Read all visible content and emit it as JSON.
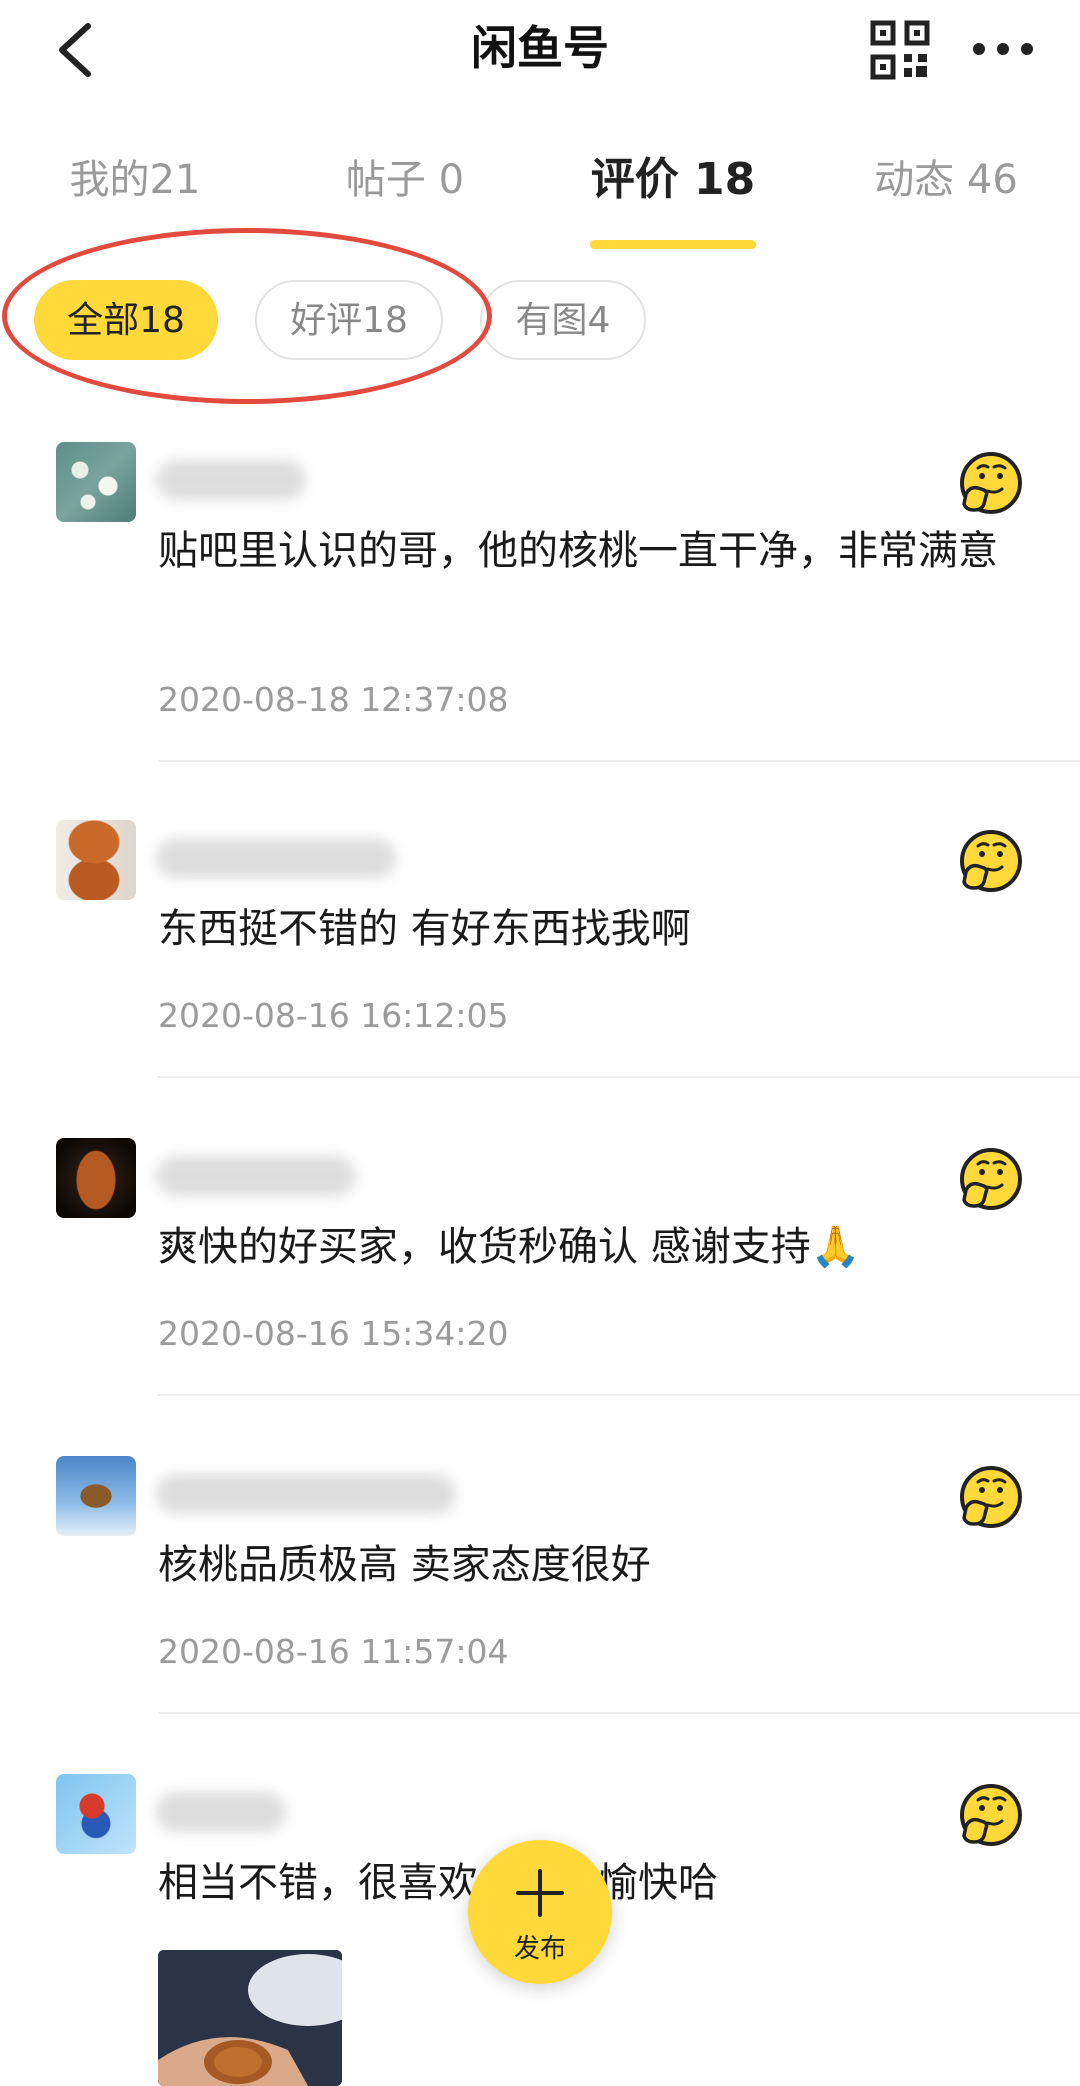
{
  "header": {
    "title": "闲鱼号",
    "back_icon": "chevron-left-icon",
    "qr_icon": "qr-code-icon",
    "more_icon": "more-dots-icon"
  },
  "tabs": [
    {
      "label": "我的21",
      "active": false
    },
    {
      "label": "帖子 0",
      "active": false
    },
    {
      "label": "评价 18",
      "active": true
    },
    {
      "label": "动态 46",
      "active": false
    }
  ],
  "filters": [
    {
      "label": "全部18",
      "active": true
    },
    {
      "label": "好评18",
      "active": false
    },
    {
      "label": "有图4",
      "active": false
    }
  ],
  "reviews": [
    {
      "text": "贴吧里认识的哥，他的核桃一直干净，非常满意",
      "time": "2020-08-18 12:37:08",
      "emoji": "thinking-face-icon"
    },
    {
      "text": "东西挺不错的 有好东西找我啊",
      "time": "2020-08-16 16:12:05",
      "emoji": "thinking-face-icon"
    },
    {
      "text": "爽快的好买家，收货秒确认 感谢支持🙏",
      "time": "2020-08-16 15:34:20",
      "emoji": "thinking-face-icon"
    },
    {
      "text": "核桃品质极高 卖家态度很好",
      "time": "2020-08-16 11:57:04",
      "emoji": "thinking-face-icon"
    },
    {
      "text": "相当不错，很喜欢，交易愉快哈",
      "time": "",
      "emoji": "thinking-face-icon"
    }
  ],
  "fab": {
    "label": "发布",
    "icon": "plus-icon"
  },
  "colors": {
    "accent": "#ffd83a",
    "annotation": "#e34a3e",
    "muted_text": "#9b9b9b"
  }
}
